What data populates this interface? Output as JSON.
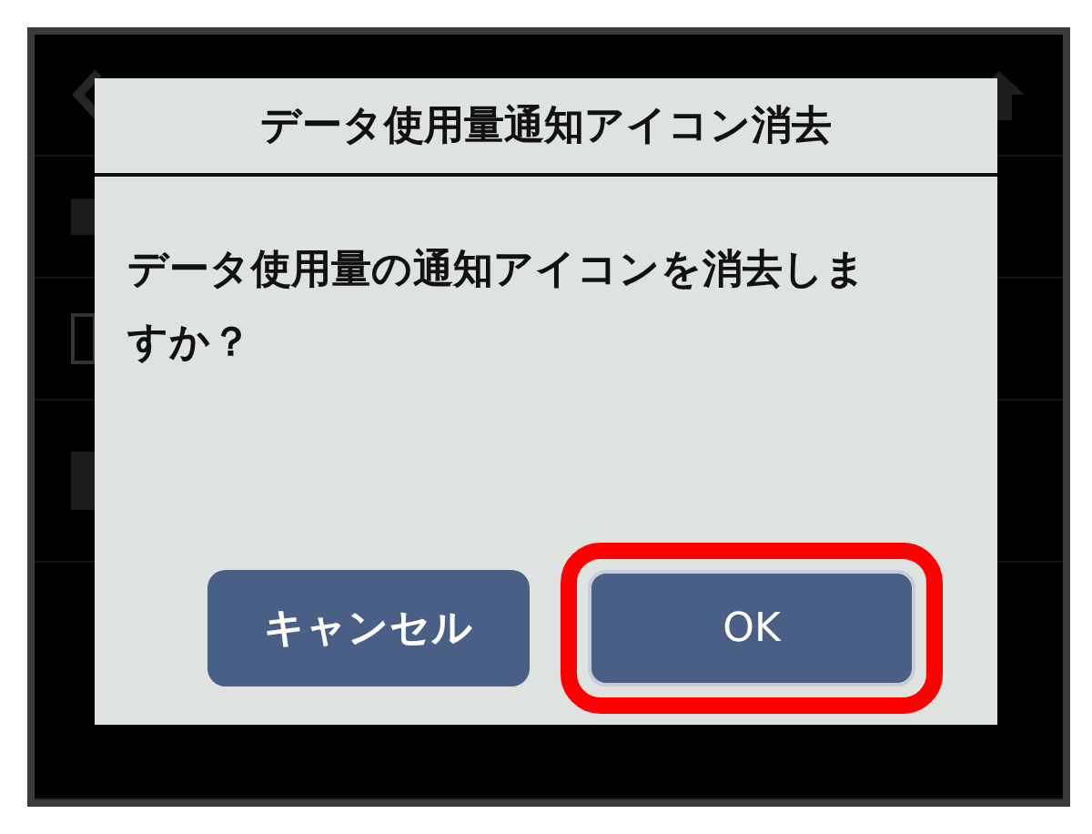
{
  "dialog": {
    "title": "データ使用量通知アイコン消去",
    "message": "データ使用量の通知アイコンを消去しますか？",
    "buttons": [
      {
        "label": "キャンセル",
        "kind": "cancel",
        "selected": false
      },
      {
        "label": "OK",
        "kind": "ok",
        "selected": true
      }
    ]
  }
}
